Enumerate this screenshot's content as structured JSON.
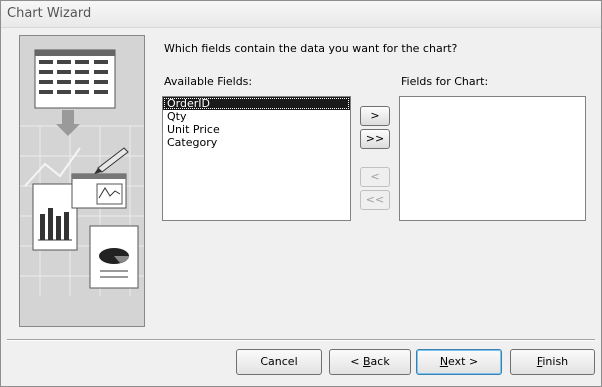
{
  "window": {
    "title": "Chart Wizard"
  },
  "prompt": "Which fields contain the data you want for the chart?",
  "available": {
    "label": "Available Fields:",
    "items": [
      "OrderID",
      "Qty",
      "Unit Price",
      "Category"
    ],
    "selected_index": 0
  },
  "chosen": {
    "label": "Fields for Chart:",
    "items": []
  },
  "move_buttons": {
    "add_one": ">",
    "add_all": ">>",
    "remove_one": "<",
    "remove_all": "<<"
  },
  "buttons": {
    "cancel": "Cancel",
    "back_prefix": "< ",
    "back_mnemonic": "B",
    "back_rest": "ack",
    "next_mnemonic": "N",
    "next_rest": "ext >",
    "finish_mnemonic": "F",
    "finish_rest": "inish"
  }
}
